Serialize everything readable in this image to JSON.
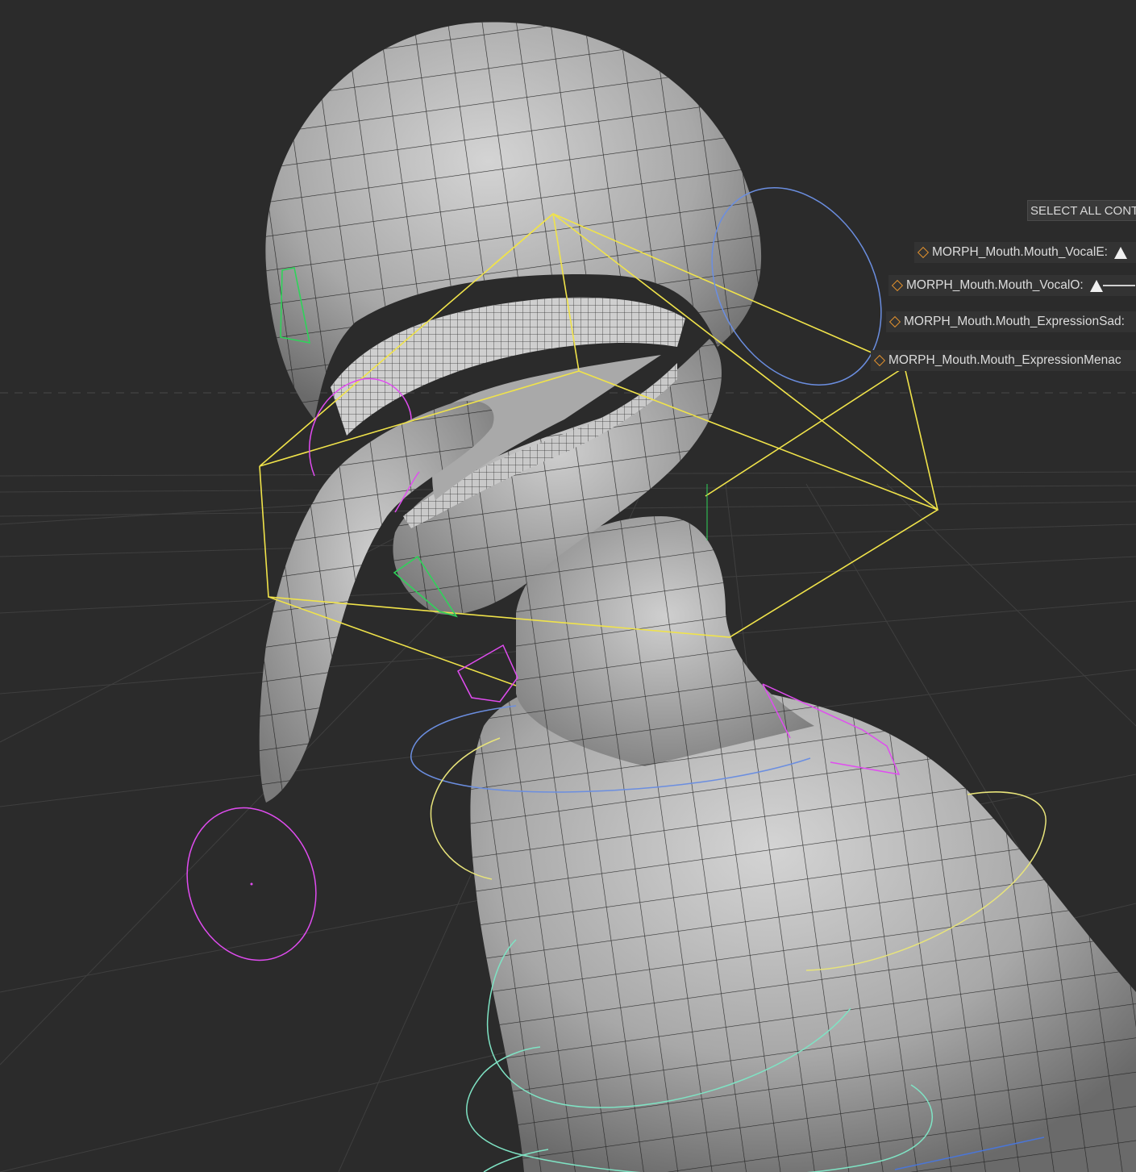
{
  "toolbar": {
    "select_all_label": "SELECT ALL CONT"
  },
  "morph_controls": [
    {
      "label": "MORPH_Mouth.Mouth_VocalE:",
      "has_slider": true
    },
    {
      "label": "MORPH_Mouth.Mouth_VocalO:",
      "has_slider": true
    },
    {
      "label": "MORPH_Mouth.Mouth_ExpressionSad:",
      "has_slider": false
    },
    {
      "label": "MORPH_Mouth.Mouth_ExpressionMenac",
      "has_slider": false
    }
  ],
  "colors": {
    "background": "#2b2b2b",
    "mesh_fill": "#b9b9b9",
    "wire": "#1a1a1a",
    "head_control": "#f0e34a",
    "jaw_control": "#e04cf0",
    "lip_control": "#2fd35a",
    "neck_control_blue": "#5b7bd8",
    "neck_control_yellow": "#e8e47a",
    "chest_control": "#7fe3c4",
    "key_diamond": "#e0902d"
  }
}
